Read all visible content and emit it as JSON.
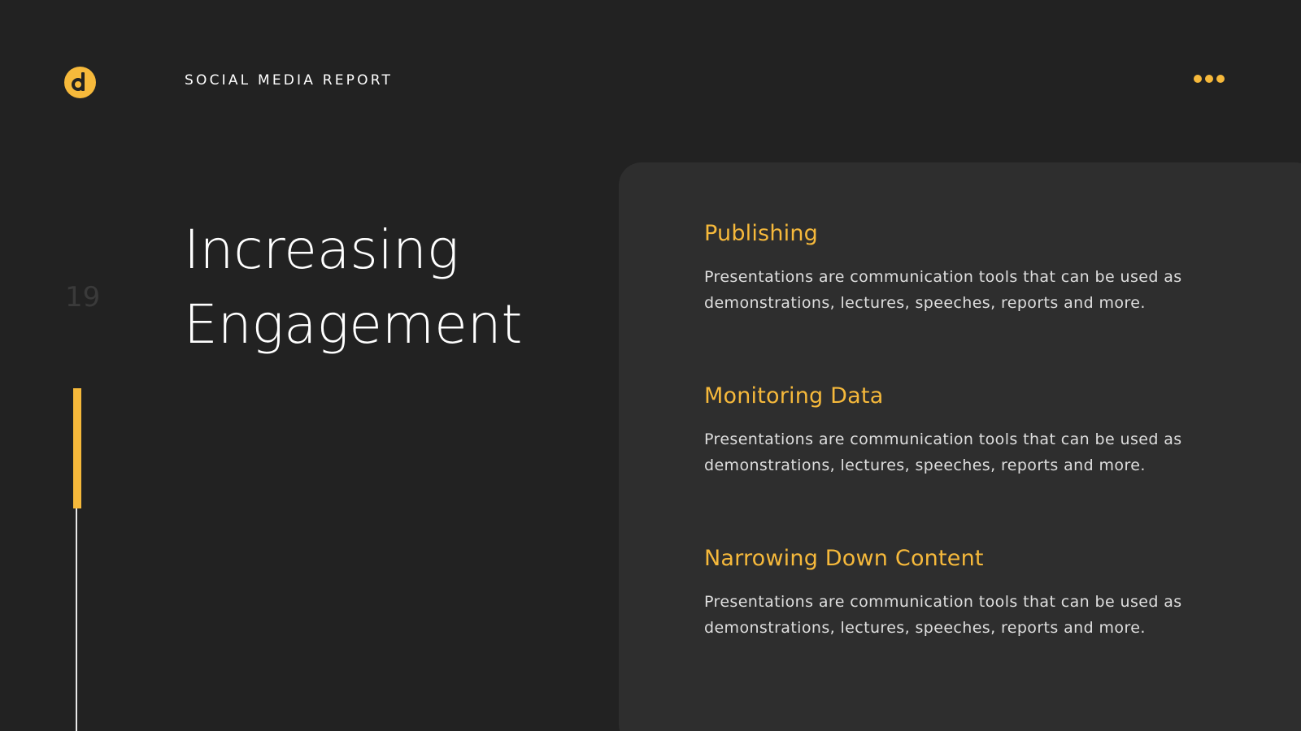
{
  "header": {
    "logo_letter": "d",
    "report_title": "SOCIAL MEDIA REPORT"
  },
  "page_number": "19",
  "title": {
    "line1": "Increasing",
    "line2": "Engagement"
  },
  "progress": {
    "fraction": 0.35
  },
  "sections": [
    {
      "heading": "Publishing",
      "body": "Presentations are communication tools that can be used as demonstrations, lectures, speeches, reports and more."
    },
    {
      "heading": "Monitoring Data",
      "body": "Presentations are communication tools that can be used as demonstrations, lectures, speeches, reports and more."
    },
    {
      "heading": "Narrowing Down Content",
      "body": "Presentations are communication tools that can be used as demonstrations, lectures, speeches, reports and more."
    }
  ],
  "icons": {
    "logo": "brand-logo-icon",
    "menu": "more-dots-icon"
  },
  "colors": {
    "background": "#222222",
    "card": "#2e2e2e",
    "accent": "#f6b93b",
    "text": "#ffffff"
  }
}
